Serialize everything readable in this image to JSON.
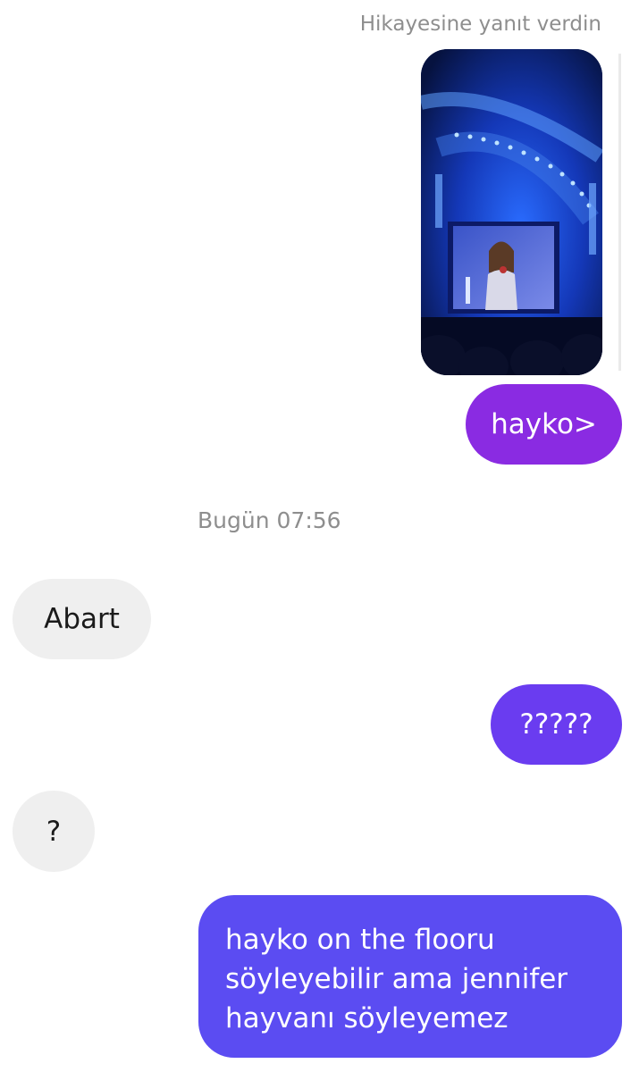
{
  "story_reply": {
    "label": "Hikayesine yanıt verdin",
    "image_description": "Concert photo of a performer on stage in blue light"
  },
  "messages": [
    {
      "sender": "me",
      "text": "hayko>"
    },
    {
      "sender": "them",
      "text": "Abart"
    },
    {
      "sender": "me",
      "text": "?????"
    },
    {
      "sender": "them",
      "text": "?"
    },
    {
      "sender": "me",
      "lines": [
        "hayko on the flooru",
        "söyleyebilir ama jennifer",
        "hayvanı söyleyemez"
      ]
    }
  ],
  "timestamp": "Bugün 07:56",
  "colors": {
    "sent_1": "#8a2be2",
    "sent_2": "#6a3cf0",
    "sent_3": "#5b4cf2",
    "received": "#efefef"
  }
}
